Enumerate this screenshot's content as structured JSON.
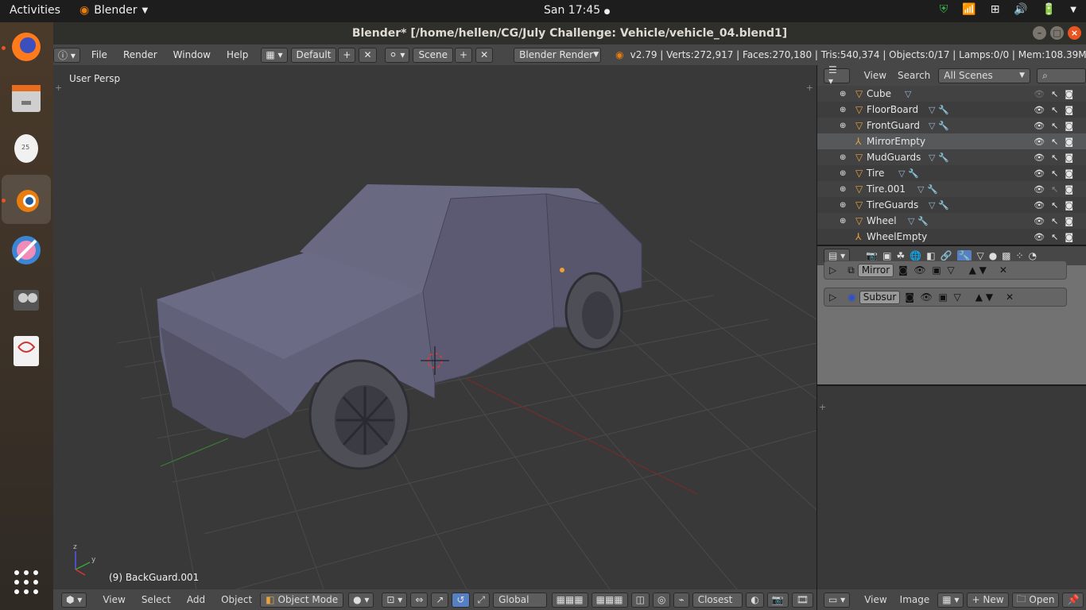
{
  "gnome": {
    "activities": "Activities",
    "app_name": "Blender",
    "clock": "San 17:45"
  },
  "window": {
    "title": "Blender* [/home/hellen/CG/July Challenge: Vehicle/vehicle_04.blend1]"
  },
  "info_header": {
    "menus": [
      "File",
      "Render",
      "Window",
      "Help"
    ],
    "layout": "Default",
    "scene": "Scene",
    "engine": "Blender Render",
    "stats": "v2.79 | Verts:272,917 | Faces:270,180 | Tris:540,374 | Objects:0/17 | Lamps:0/0 | Mem:108.39M | Bac"
  },
  "viewport": {
    "view_label": "User Persp",
    "object_label": "(9) BackGuard.001"
  },
  "view3d_footer": {
    "menus": [
      "View",
      "Select",
      "Add",
      "Object"
    ],
    "mode": "Object Mode",
    "orientation": "Global",
    "snap": "Closest"
  },
  "outliner": {
    "menus": [
      "View",
      "Search"
    ],
    "filter": "All Scenes",
    "items": [
      {
        "name": "Cube",
        "type": "mesh",
        "mods": "▽"
      },
      {
        "name": "FloorBoard",
        "type": "mesh",
        "mods": "▽ 🔧"
      },
      {
        "name": "FrontGuard",
        "type": "mesh",
        "mods": "▽ 🔧"
      },
      {
        "name": "MirrorEmpty",
        "type": "empty",
        "mods": ""
      },
      {
        "name": "MudGuards",
        "type": "mesh",
        "mods": "▽ 🔧"
      },
      {
        "name": "Tire",
        "type": "mesh",
        "mods": "▽ 🔧"
      },
      {
        "name": "Tire.001",
        "type": "mesh",
        "mods": "▽ 🔧"
      },
      {
        "name": "TireGuards",
        "type": "mesh",
        "mods": "▽ 🔧"
      },
      {
        "name": "Wheel",
        "type": "mesh",
        "mods": "▽ 🔧"
      },
      {
        "name": "WheelEmpty",
        "type": "empty",
        "mods": ""
      }
    ]
  },
  "modifiers": [
    {
      "name": "Mirror"
    },
    {
      "name": "Subsur"
    }
  ],
  "image_footer": {
    "menus": [
      "View",
      "Image"
    ],
    "new_label": "New",
    "open_label": "Open"
  }
}
